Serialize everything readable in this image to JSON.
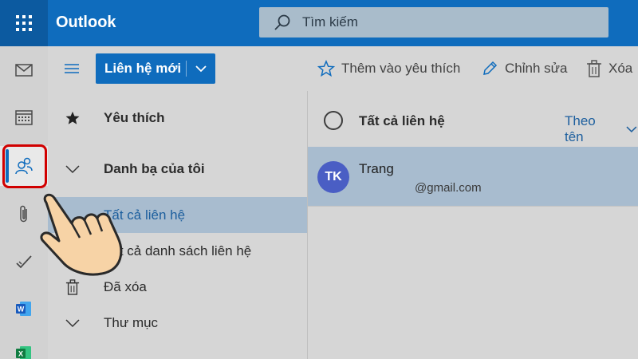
{
  "app": {
    "name": "Outlook"
  },
  "search": {
    "placeholder": "Tìm kiếm"
  },
  "rail": {
    "items": [
      {
        "name": "mail-icon"
      },
      {
        "name": "calendar-icon"
      },
      {
        "name": "people-icon",
        "active": true
      },
      {
        "name": "paperclip-icon"
      },
      {
        "name": "todo-check-icon"
      },
      {
        "name": "word-icon"
      },
      {
        "name": "excel-icon"
      }
    ]
  },
  "toolbar": {
    "new_contact_label": "Liên hệ mới",
    "add_favorite_label": "Thêm vào yêu thích",
    "edit_label": "Chỉnh sửa",
    "delete_label": "Xóa"
  },
  "folders": {
    "favorites_label": "Yêu thích",
    "my_contacts_label": "Danh bạ của tôi",
    "all_contacts_label": "Tất cả liên hệ",
    "all_contact_lists_label": "Tất cả danh sách liên hệ",
    "deleted_label": "Đã xóa",
    "folders_label": "Thư mục"
  },
  "list": {
    "header_title": "Tất cả liên hệ",
    "sort_label": "Theo tên",
    "contacts": [
      {
        "initials": "TK",
        "name": "Trang",
        "email": "@gmail.com"
      }
    ]
  },
  "colors": {
    "accent": "#0f6cbd",
    "selection": "#a8bccf",
    "avatar": "#4a5ec4",
    "highlight": "#d10000"
  }
}
